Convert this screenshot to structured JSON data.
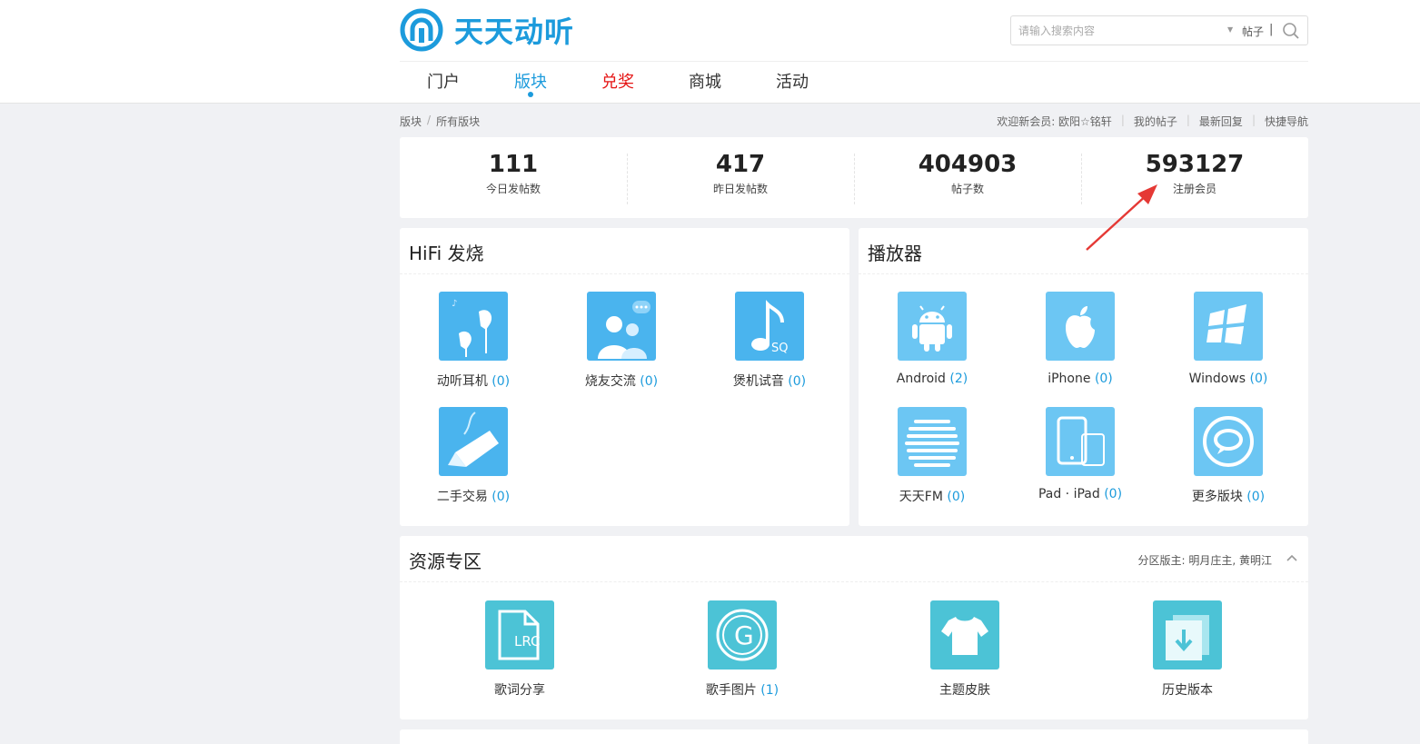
{
  "site": {
    "logo_text": "天天动听"
  },
  "search": {
    "placeholder": "请输入搜索内容",
    "type_label": "帖子",
    "separator": "|"
  },
  "nav": [
    {
      "label": "门户"
    },
    {
      "label": "版块"
    },
    {
      "label": "兑奖"
    },
    {
      "label": "商城"
    },
    {
      "label": "活动"
    }
  ],
  "breadcrumb": {
    "items": [
      "版块",
      "所有版块"
    ],
    "separator": "/"
  },
  "toplinks": {
    "welcome": "欢迎新会员: 欧阳☆铭轩",
    "my_posts": "我的帖子",
    "latest_replies": "最新回复",
    "quick_nav": "快捷导航"
  },
  "stats": [
    {
      "value": "111",
      "label": "今日发帖数"
    },
    {
      "value": "417",
      "label": "昨日发帖数"
    },
    {
      "value": "404903",
      "label": "帖子数"
    },
    {
      "value": "593127",
      "label": "注册会员"
    }
  ],
  "sections": {
    "hifi": {
      "title": "HiFi 发烧",
      "forums": [
        {
          "name": "动听耳机",
          "count": "(0)",
          "icon": "earphones-icon"
        },
        {
          "name": "烧友交流",
          "count": "(0)",
          "icon": "chat-people-icon"
        },
        {
          "name": "煲机试音",
          "count": "(0)",
          "icon": "music-note-sq-icon"
        },
        {
          "name": "二手交易",
          "count": "(0)",
          "icon": "tag-icon"
        }
      ]
    },
    "player": {
      "title": "播放器",
      "forums": [
        {
          "name": "Android",
          "count": "(2)",
          "icon": "android-icon"
        },
        {
          "name": "iPhone",
          "count": "(0)",
          "icon": "apple-icon"
        },
        {
          "name": "Windows",
          "count": "(0)",
          "icon": "windows-icon"
        },
        {
          "name": "天天FM",
          "count": "(0)",
          "icon": "fm-wave-icon"
        },
        {
          "name": "Pad · iPad",
          "count": "(0)",
          "icon": "tablet-icon"
        },
        {
          "name": "更多版块",
          "count": "(0)",
          "icon": "more-bubble-icon"
        }
      ]
    },
    "resources": {
      "title": "资源专区",
      "moderator": "分区版主: 明月庄主, 黄明江",
      "forums": [
        {
          "name": "歌词分享",
          "count": "",
          "icon": "lrc-file-icon",
          "icon_text": "LRC"
        },
        {
          "name": "歌手图片",
          "count": "(1)",
          "icon": "g-circle-icon",
          "icon_text": "G"
        },
        {
          "name": "主题皮肤",
          "count": "",
          "icon": "tshirt-icon"
        },
        {
          "name": "历史版本",
          "count": "",
          "icon": "download-icon"
        }
      ]
    }
  },
  "colors": {
    "brand": "#1c9bdc",
    "redlink": "#e51515",
    "icon_blue": "#4ab4ee",
    "icon_light": "#6cc6f3",
    "icon_teal": "#4cc3d6",
    "annotation_arrow": "#e53935"
  }
}
